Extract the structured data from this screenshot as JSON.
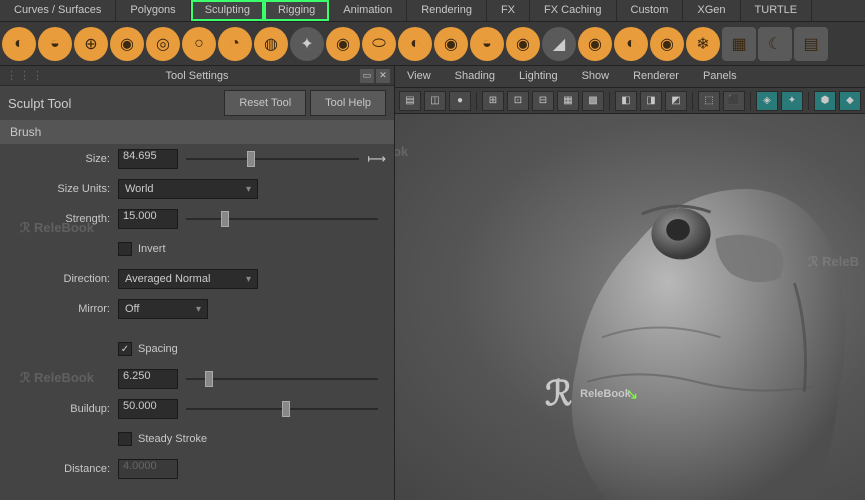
{
  "menubar": [
    "Curves / Surfaces",
    "Polygons",
    "Sculpting",
    "Rigging",
    "Animation",
    "Rendering",
    "FX",
    "FX Caching",
    "Custom",
    "XGen",
    "TURTLE"
  ],
  "menubar_active": [
    2,
    3
  ],
  "panel": {
    "title": "Tool Settings",
    "tool": "Sculpt Tool",
    "reset": "Reset Tool",
    "help": "Tool Help",
    "section": "Brush"
  },
  "fields": {
    "size": {
      "label": "Size:",
      "value": "84.695",
      "thumb": 35
    },
    "sizeUnits": {
      "label": "Size Units:",
      "value": "World"
    },
    "strength": {
      "label": "Strength:",
      "value": "15.000",
      "thumb": 18
    },
    "invert": {
      "label": "Invert"
    },
    "direction": {
      "label": "Direction:",
      "value": "Averaged Normal"
    },
    "mirror": {
      "label": "Mirror:",
      "value": "Off"
    },
    "spacing": {
      "label": "Spacing",
      "value": "6.250",
      "thumb": 10
    },
    "buildup": {
      "label": "Buildup:",
      "value": "50.000",
      "thumb": 50
    },
    "steady": {
      "label": "Steady Stroke"
    },
    "distance": {
      "label": "Distance:",
      "value": "4.0000"
    }
  },
  "viewport": {
    "menus": [
      "View",
      "Shading",
      "Lighting",
      "Show",
      "Renderer",
      "Panels"
    ]
  },
  "watermark": "ReleBook"
}
